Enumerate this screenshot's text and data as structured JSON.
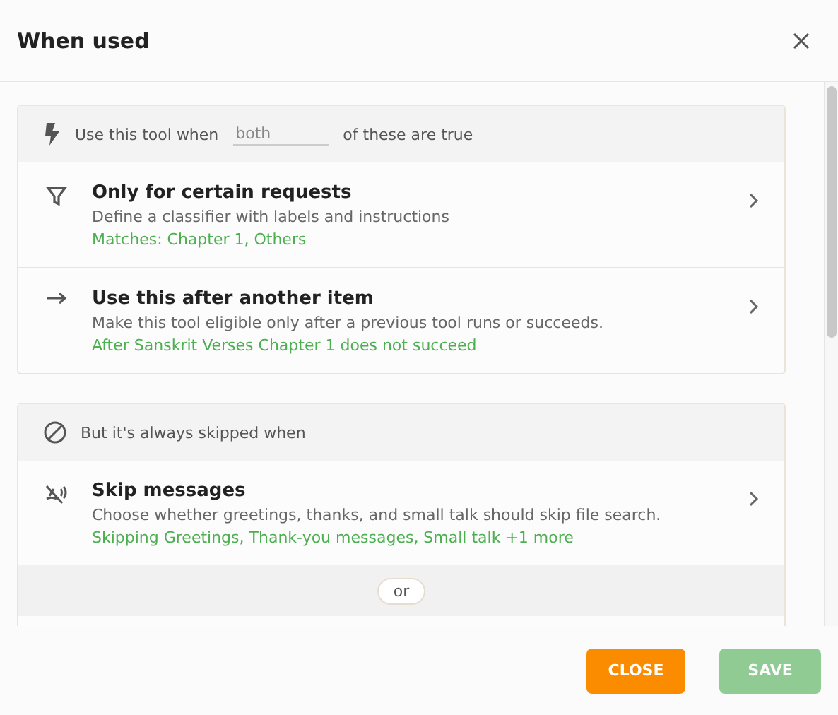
{
  "dialog": {
    "title": "When used"
  },
  "conditions": {
    "prefix": "Use this tool when",
    "mode": "both",
    "suffix": "of these are true",
    "items": [
      {
        "kind": "filter",
        "title": "Only for certain requests",
        "description": "Define a classifier with labels and instructions",
        "summary": "Matches: Chapter 1, Others"
      },
      {
        "kind": "after",
        "title": "Use this after another item",
        "description": "Make this tool eligible only after a previous tool runs or succeeds.",
        "summary": "After Sanskrit Verses Chapter 1 does not succeed"
      }
    ]
  },
  "exceptions": {
    "heading": "But it's always skipped when",
    "items": [
      {
        "kind": "mute",
        "title": "Skip messages",
        "description": "Choose whether greetings, thanks, and small talk should skip file search.",
        "summary": "Skipping Greetings, Thank-you messages, Small talk +1 more"
      }
    ],
    "separator": "or"
  },
  "buttons": [
    {
      "kind": "close",
      "label": "CLOSE",
      "disabled": false
    },
    {
      "kind": "save",
      "label": "SAVE",
      "disabled": true
    }
  ]
}
